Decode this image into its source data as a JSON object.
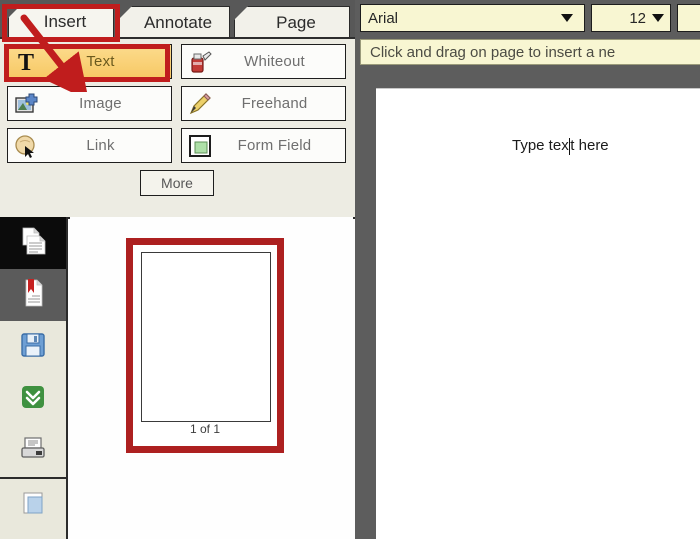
{
  "tabs": [
    {
      "id": "insert",
      "label": "Insert",
      "active": true
    },
    {
      "id": "annotate",
      "label": "Annotate",
      "active": false
    },
    {
      "id": "page",
      "label": "Page",
      "active": false
    }
  ],
  "toolbar": {
    "buttons": [
      {
        "label": "Text",
        "icon": "text-t-icon",
        "selected": true
      },
      {
        "label": "Whiteout",
        "icon": "whiteout-icon",
        "selected": false
      },
      {
        "label": "Image",
        "icon": "image-add-icon",
        "selected": false
      },
      {
        "label": "Freehand",
        "icon": "pencil-icon",
        "selected": false
      },
      {
        "label": "Link",
        "icon": "link-cursor-icon",
        "selected": false
      },
      {
        "label": "Form Field",
        "icon": "form-field-icon",
        "selected": false
      }
    ],
    "more_label": "More"
  },
  "side_rail": {
    "items": [
      {
        "name": "pages",
        "icon": "pages-icon",
        "state": "active"
      },
      {
        "name": "bookmarks",
        "icon": "bookmark-icon",
        "state": "hover"
      },
      {
        "name": "save",
        "icon": "floppy-save-icon",
        "state": "normal"
      },
      {
        "name": "download",
        "icon": "download-icon",
        "state": "normal"
      },
      {
        "name": "print",
        "icon": "printer-icon",
        "state": "normal"
      },
      {
        "name": "document",
        "icon": "document-icon",
        "state": "normal"
      }
    ]
  },
  "thumbnails": {
    "caption": "1 of 1",
    "selected_index": 0
  },
  "font_bar": {
    "font_name": "Arial",
    "font_size": "12"
  },
  "hint": {
    "text": "Click and drag on page to insert a ne"
  },
  "document": {
    "text_before_caret": "Type tex",
    "text_after_caret": "t here"
  },
  "annotations": {
    "tab_highlight": "Insert",
    "button_highlight": "Text",
    "arrow": "red-arrow-insert-to-text"
  },
  "colors": {
    "annotation_red": "#c01d1d",
    "selected_button": "#f7c864",
    "combo_yellow": "#f8f6d2",
    "panel_bg": "#edece3",
    "canvas_bg": "#5d5d5d"
  }
}
